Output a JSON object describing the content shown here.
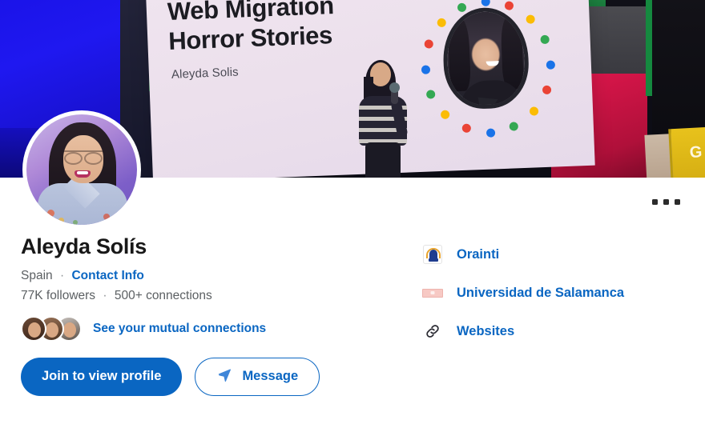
{
  "banner": {
    "slide_title": "Web Migration\nHorror Stories",
    "slide_subtitle": "Aleyda Solis",
    "lectern_letter": "G",
    "icons": {
      "speaker_photo": "speaker-portrait-bubble",
      "stage_speaker": "speaker-silhouette"
    },
    "dot_colors": [
      "#1a73e8",
      "#ea4335",
      "#fbbc04",
      "#34a853"
    ]
  },
  "profile": {
    "name": "Aleyda Solís",
    "location": "Spain",
    "contact_info_label": "Contact Info",
    "followers": "77K followers",
    "connections": "500+ connections",
    "separator": "·"
  },
  "mutual": {
    "label": "See your mutual connections",
    "avatar_count": 3
  },
  "actions": {
    "primary_label": "Join to view profile",
    "secondary_label": "Message",
    "secondary_icon": "send-icon"
  },
  "more_menu": {
    "name": "more-options",
    "dots": 3
  },
  "experience_links": [
    {
      "label": "Orainti",
      "icon": "orainti-logo-icon"
    },
    {
      "label": "Universidad de Salamanca",
      "icon": "universidad-de-salamanca-logo-icon"
    },
    {
      "label": "Websites",
      "icon": "link-chain-icon"
    }
  ],
  "colors": {
    "link_blue": "#0a66c2",
    "text_primary": "#181818",
    "text_secondary": "#5c6063",
    "background": "#ffffff"
  }
}
